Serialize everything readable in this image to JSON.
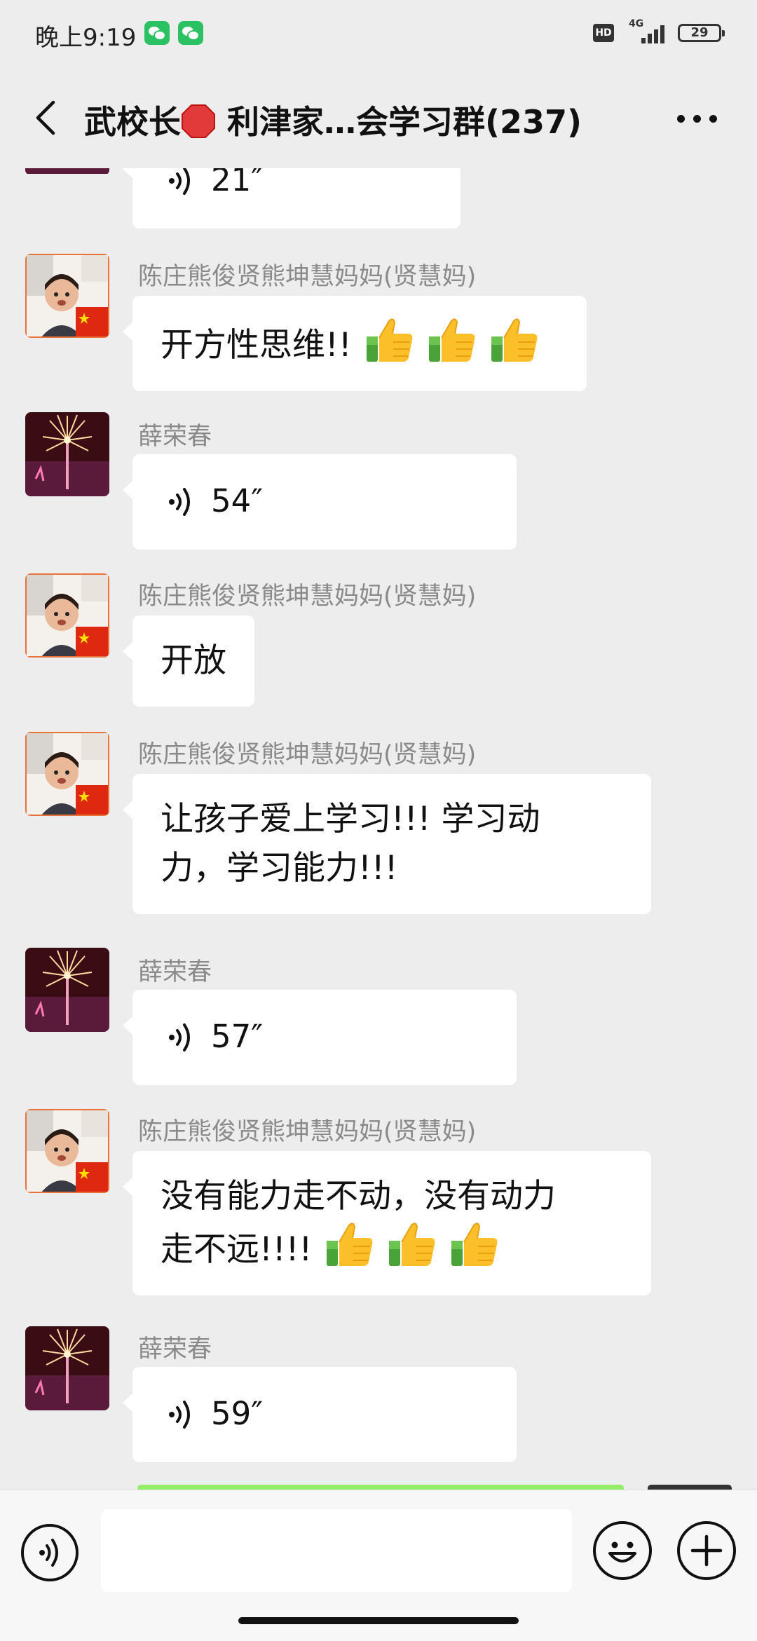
{
  "status_bar": {
    "time": "晚上9:19",
    "hd_badge": "HD",
    "network": "4G",
    "battery": "29",
    "notification_icons": [
      "wechat-icon",
      "wechat-icon"
    ]
  },
  "header": {
    "title_prefix": "武校长",
    "title_emoji": "stop-sign-icon",
    "title_suffix": " 利津家…会学习群(237)",
    "back_icon": "chevron-left-icon",
    "more_icon": "more-dots-icon"
  },
  "messages": [
    {
      "type": "voice",
      "sender": "",
      "duration": "21″",
      "avatar": "fireworks-avatar"
    },
    {
      "type": "text",
      "sender": "陈庄熊俊贤熊坤慧妈妈(贤慧妈)",
      "text": "开方性思维!!",
      "thumbs": 3,
      "avatar": "child-flag-avatar"
    },
    {
      "type": "voice",
      "sender": "薛荣春",
      "duration": "54″",
      "avatar": "fireworks-avatar"
    },
    {
      "type": "text",
      "sender": "陈庄熊俊贤熊坤慧妈妈(贤慧妈)",
      "text": "开放",
      "thumbs": 0,
      "avatar": "child-flag-avatar"
    },
    {
      "type": "text",
      "sender": "陈庄熊俊贤熊坤慧妈妈(贤慧妈)",
      "text_line1": "让孩子爱上学习!!! 学习动",
      "text_line2": "力，学习能力!!!",
      "thumbs": 0,
      "avatar": "child-flag-avatar"
    },
    {
      "type": "voice",
      "sender": "薛荣春",
      "duration": "57″",
      "avatar": "fireworks-avatar"
    },
    {
      "type": "text",
      "sender": "陈庄熊俊贤熊坤慧妈妈(贤慧妈)",
      "text_line1": "没有能力走不动，没有动力",
      "text_line2": "走不远!!!!",
      "thumbs": 3,
      "avatar": "child-flag-avatar"
    },
    {
      "type": "voice",
      "sender": "薛荣春",
      "duration": "59″",
      "avatar": "fireworks-avatar"
    }
  ],
  "input_bar": {
    "voice_toggle_icon": "voice-mode-icon",
    "input_value": "",
    "emoji_icon": "emoji-icon",
    "plus_icon": "plus-icon"
  },
  "colors": {
    "background": "#ededed",
    "bubble": "#ffffff",
    "sender_name": "#8a8a8a",
    "wechat_green": "#2ac162",
    "outgoing_bubble": "#95ec69"
  }
}
